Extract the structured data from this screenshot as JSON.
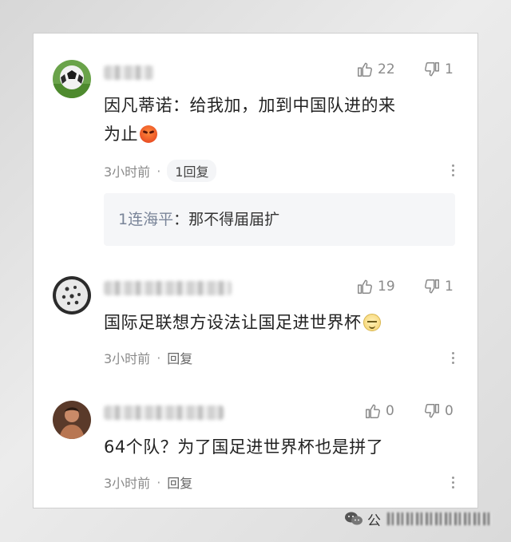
{
  "comments": [
    {
      "likes": "22",
      "dislikes": "1",
      "text_line1": "因凡蒂诺：给我加，加到中国队进的来",
      "text_line2": "为止",
      "time": "3小时前",
      "reply_label": "1回复",
      "reply": {
        "user": "1连海平",
        "separator": "：",
        "text": "那不得届届扩"
      }
    },
    {
      "likes": "19",
      "dislikes": "1",
      "text": "国际足联想方设法让国足进世界杯",
      "time": "3小时前",
      "reply_label": "回复"
    },
    {
      "likes": "0",
      "dislikes": "0",
      "text": "64个队？为了国足进世界杯也是拼了",
      "time": "3小时前",
      "reply_label": "回复"
    }
  ],
  "icons": {
    "like": "thumbs-up-icon",
    "dislike": "thumbs-down-icon",
    "more": "more-vertical-icon",
    "wechat": "wechat-icon"
  },
  "watermark": {
    "prefix": "公"
  },
  "colors": {
    "text": "#222222",
    "muted": "#8a8a8a",
    "reply_user": "#7a8599",
    "reply_bg": "#f5f6f8"
  }
}
